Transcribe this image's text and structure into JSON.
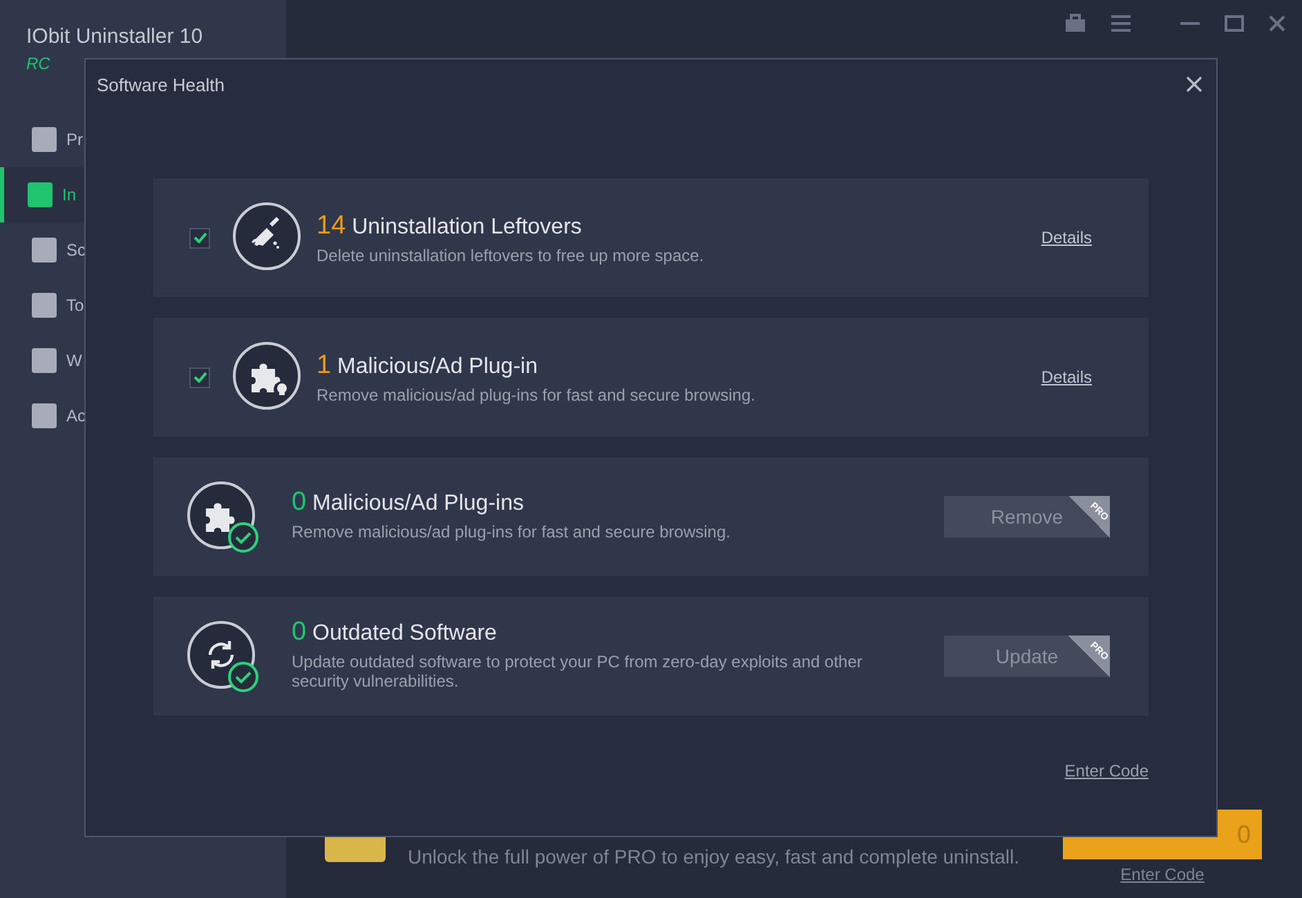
{
  "app": {
    "title": "IObit Uninstaller 10",
    "edition": "RC",
    "sidebar": [
      {
        "label": "Pr",
        "selected": false
      },
      {
        "label": "In",
        "selected": true
      },
      {
        "label": "Sc",
        "selected": false
      },
      {
        "label": "To",
        "selected": false
      },
      {
        "label": "W",
        "selected": false
      },
      {
        "label": "Ac",
        "selected": false
      }
    ],
    "banner": {
      "text": "Unlock the full power of PRO to enjoy easy, fast and complete uninstall.",
      "button_label": "0",
      "link": "Enter Code"
    }
  },
  "dialog": {
    "title": "Software Health",
    "items": [
      {
        "kind": "issue",
        "checked": true,
        "count": "14",
        "title": "Uninstallation Leftovers",
        "description": "Delete uninstallation leftovers to free up more space.",
        "link": "Details"
      },
      {
        "kind": "issue",
        "checked": true,
        "count": "1",
        "title": "Malicious/Ad Plug-in",
        "description": "Remove malicious/ad plug-ins for fast and secure browsing.",
        "link": "Details"
      },
      {
        "kind": "clean",
        "count": "0",
        "title": "Malicious/Ad Plug-ins",
        "description": "Remove malicious/ad plug-ins for fast and secure browsing.",
        "action": "Remove",
        "badge": "PRO"
      },
      {
        "kind": "clean",
        "count": "0",
        "title": "Outdated Software",
        "description": "Update outdated software to protect your PC from zero-day exploits and other security vulnerabilities.",
        "action": "Update",
        "badge": "PRO"
      }
    ],
    "footer_link": "Enter Code"
  }
}
